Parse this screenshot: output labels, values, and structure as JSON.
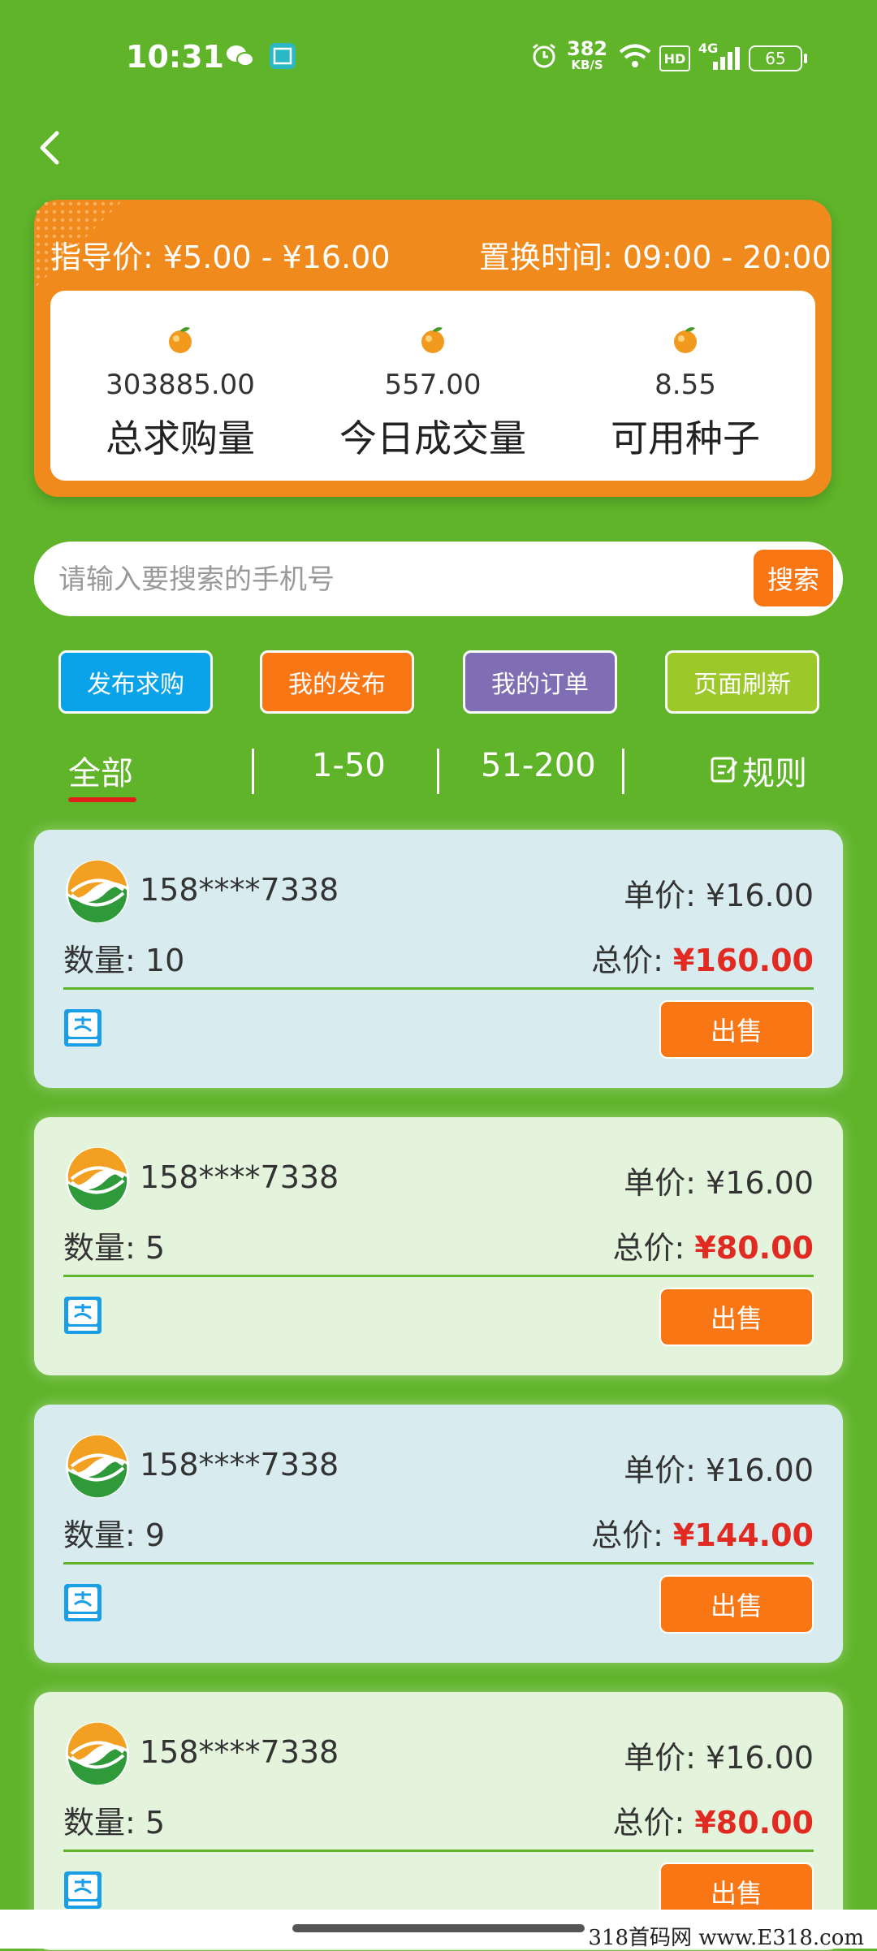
{
  "status_bar": {
    "time": "10:31",
    "net_speed_value": "382",
    "net_speed_unit": "KB/S",
    "hd": "HD",
    "network": "4G",
    "battery": "65"
  },
  "summary": {
    "guide_price": "指导价:  ¥5.00 - ¥16.00",
    "swap_time": "置换时间:  09:00 - 20:00",
    "stats": [
      {
        "value": "303885.00",
        "label": "总求购量"
      },
      {
        "value": "557.00",
        "label": "今日成交量"
      },
      {
        "value": "8.55",
        "label": "可用种子"
      }
    ]
  },
  "search": {
    "placeholder": "请输入要搜索的手机号",
    "button": "搜索"
  },
  "actions": [
    {
      "label": "发布求购",
      "color": "#0aa3ea"
    },
    {
      "label": "我的发布",
      "color": "#f97615"
    },
    {
      "label": "我的订单",
      "color": "#7f6eb4"
    },
    {
      "label": "页面刷新",
      "color": "#9cc82a"
    }
  ],
  "tabs": {
    "all": "全部",
    "range1": "1-50",
    "range2": "51-200",
    "rules": "规则"
  },
  "orders": [
    {
      "phone": "158****7338",
      "unit_label": "单价:",
      "unit_price": "¥16.00",
      "qty_label": "数量:",
      "qty": "10",
      "total_label": "总价:",
      "total": "¥160.00",
      "sell": "出售"
    },
    {
      "phone": "158****7338",
      "unit_label": "单价:",
      "unit_price": "¥16.00",
      "qty_label": "数量:",
      "qty": "5",
      "total_label": "总价:",
      "total": "¥80.00",
      "sell": "出售"
    },
    {
      "phone": "158****7338",
      "unit_label": "单价:",
      "unit_price": "¥16.00",
      "qty_label": "数量:",
      "qty": "9",
      "total_label": "总价:",
      "total": "¥144.00",
      "sell": "出售"
    },
    {
      "phone": "158****7338",
      "unit_label": "单价:",
      "unit_price": "¥16.00",
      "qty_label": "数量:",
      "qty": "5",
      "total_label": "总价:",
      "total": "¥80.00",
      "sell": "出售"
    }
  ],
  "watermark": "318首码网  www.E318.com"
}
